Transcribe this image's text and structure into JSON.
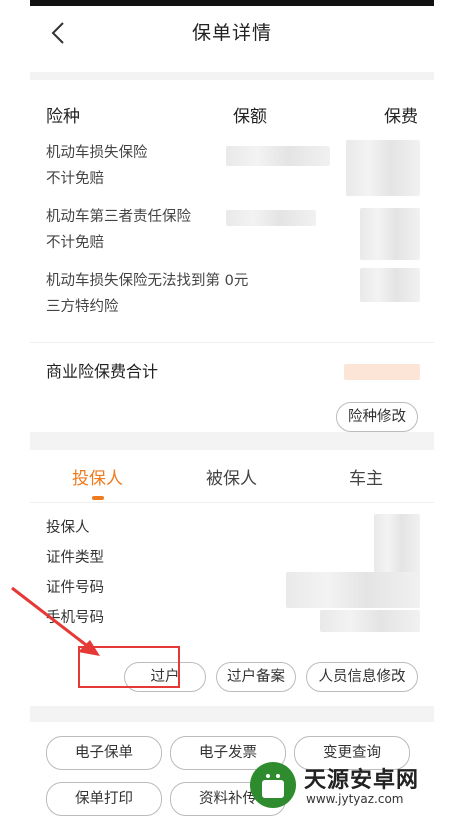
{
  "nav": {
    "title": "保单详情"
  },
  "coverage": {
    "headers": {
      "type": "险种",
      "amount": "保额",
      "premium": "保费"
    },
    "items": [
      {
        "line1": "机动车损失保险",
        "line2": "不计免赔"
      },
      {
        "line1": "机动车第三者责任保险",
        "line2": "不计免赔"
      },
      {
        "line1": "机动车损失保险无法找到第",
        "amount_text": "0元",
        "line2": "三方特约险"
      }
    ],
    "total_label": "商业险保费合计",
    "modify_button": "险种修改"
  },
  "tabs": [
    {
      "label": "投保人",
      "active": true
    },
    {
      "label": "被保人",
      "active": false
    },
    {
      "label": "车主",
      "active": false
    }
  ],
  "policyholder": {
    "fields": [
      "投保人",
      "证件类型",
      "证件号码",
      "手机号码"
    ],
    "actions": [
      "过户",
      "过户备案",
      "人员信息修改"
    ]
  },
  "bottom_actions": [
    "电子保单",
    "电子发票",
    "变更查询",
    "保单打印",
    "资料补传"
  ],
  "watermark": {
    "title": "天源安卓网",
    "url": "www.jytyaz.com"
  },
  "colors": {
    "accent": "#f07a1e",
    "highlight": "#e53935",
    "watermark_green": "#2e8b2e"
  }
}
